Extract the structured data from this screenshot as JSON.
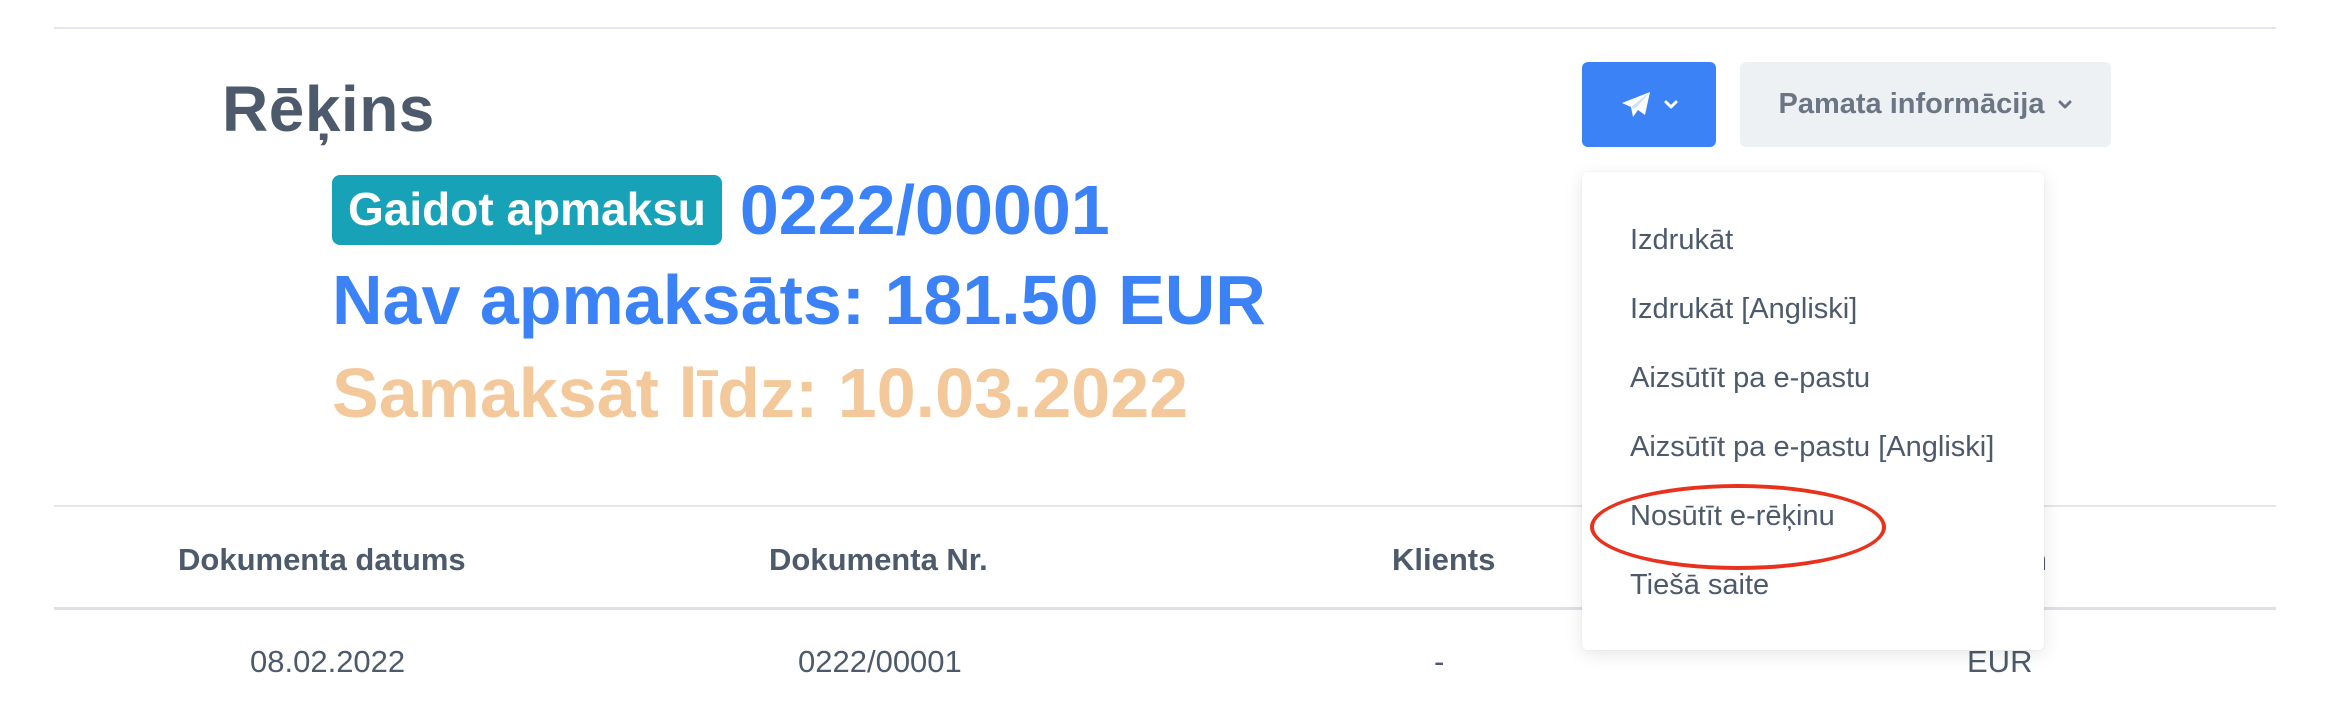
{
  "document": {
    "title": "Rēķins",
    "status": "Gaidot apmaksu",
    "number": "0222/00001",
    "unpaid": "Nav apmaksāts: 181.50 EUR",
    "due": "Samaksāt līdz: 10.03.2022"
  },
  "toolbar": {
    "send_icon": "paper-plane-icon",
    "info_label": "Pamata informācija"
  },
  "dropdown": {
    "items": [
      "Izdrukāt",
      "Izdrukāt [Angliski]",
      "Aizsūtīt pa e-pastu",
      "Aizsūtīt pa e-pastu [Angliski]",
      "Nosūtīt e-rēķinu",
      "Tiešā saite"
    ],
    "highlighted": "Nosūtīt e-rēķinu"
  },
  "table": {
    "headers": [
      "Dokumenta datums",
      "Dokumenta Nr.",
      "Klients",
      "n"
    ],
    "rows": [
      [
        "08.02.2022",
        "0222/00001",
        "-",
        "EUR"
      ]
    ]
  },
  "colors": {
    "accent": "#3b82f6",
    "status_badge": "#17a2b8",
    "due_text": "#f3c99c",
    "highlight": "#e8321e"
  }
}
